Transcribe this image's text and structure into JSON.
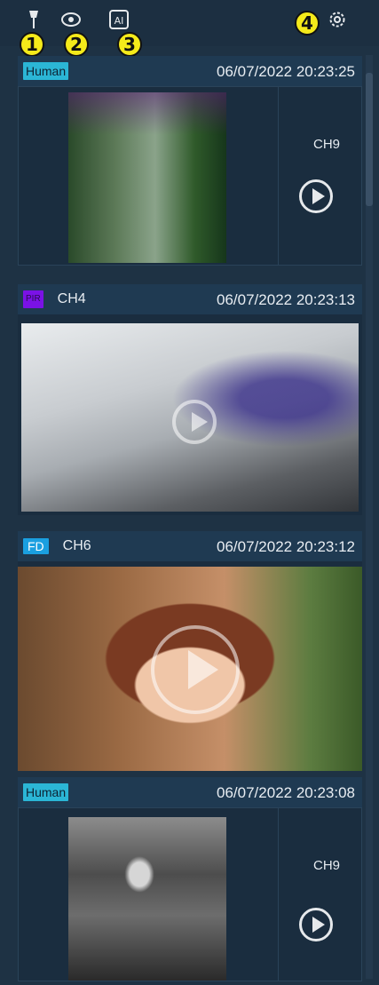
{
  "toolbar": {
    "tools": [
      {
        "icon": "pin-icon",
        "marker": "1"
      },
      {
        "icon": "eye-icon",
        "marker": "2"
      },
      {
        "icon": "ai-icon",
        "marker": "3",
        "text": "AI"
      },
      {
        "icon": "gear-icon",
        "marker": "4"
      }
    ]
  },
  "cards": [
    {
      "badge": "Human",
      "timestamp": "06/07/2022 20:23:25",
      "channel": "CH9"
    },
    {
      "badge": "PIR",
      "channel": "CH4",
      "timestamp": "06/07/2022 20:23:13"
    },
    {
      "badge": "FD",
      "channel": "CH6",
      "timestamp": "06/07/2022 20:23:12"
    },
    {
      "badge": "Human",
      "timestamp": "06/07/2022 20:23:08",
      "channel": "CH9"
    }
  ],
  "colors": {
    "background": "#1e3244",
    "header": "#1f3a52",
    "human_badge": "#2bb6d6",
    "pir_badge": "#7a12e6",
    "fd_badge": "#1a9fe0",
    "marker": "#f5ea1a"
  }
}
